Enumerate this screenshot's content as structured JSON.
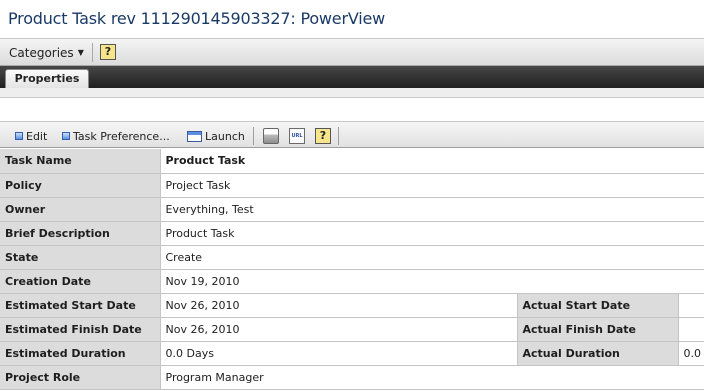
{
  "header": {
    "title": "Product Task rev 111290145903327: PowerView"
  },
  "categories_bar": {
    "menu_label": "Categories",
    "help_icon": "help-icon"
  },
  "tabs": [
    {
      "label": "Properties",
      "active": true
    }
  ],
  "toolbar": {
    "edit_label": "Edit",
    "task_preferences_label": "Task Preference...",
    "launch_label": "Launch",
    "icons": [
      "print-icon",
      "url-icon",
      "help-icon"
    ]
  },
  "properties": {
    "task_name": {
      "label": "Task Name",
      "value": "Product Task"
    },
    "policy": {
      "label": "Policy",
      "value": "Project Task"
    },
    "owner": {
      "label": "Owner",
      "value": "Everything, Test"
    },
    "brief_description": {
      "label": "Brief Description",
      "value": "Product Task"
    },
    "state": {
      "label": "State",
      "value": "Create"
    },
    "creation_date": {
      "label": "Creation Date",
      "value": "Nov 19, 2010"
    },
    "estimated_start_date": {
      "label": "Estimated Start Date",
      "value": "Nov 26, 2010"
    },
    "actual_start_date": {
      "label": "Actual Start Date",
      "value": ""
    },
    "estimated_finish_date": {
      "label": "Estimated Finish Date",
      "value": "Nov 26, 2010"
    },
    "actual_finish_date": {
      "label": "Actual Finish Date",
      "value": ""
    },
    "estimated_duration": {
      "label": "Estimated Duration",
      "value": "0.0 Days"
    },
    "actual_duration": {
      "label": "Actual Duration",
      "value": "0.0"
    },
    "project_role": {
      "label": "Project Role",
      "value": "Program Manager"
    }
  },
  "colors": {
    "title": "#1a3a66",
    "label_bg": "#dcdcdc",
    "tab_strip": "#2e2e2e",
    "toolbar_icon": "#5b8fdf",
    "help_icon_bg": "#f6e58a"
  }
}
